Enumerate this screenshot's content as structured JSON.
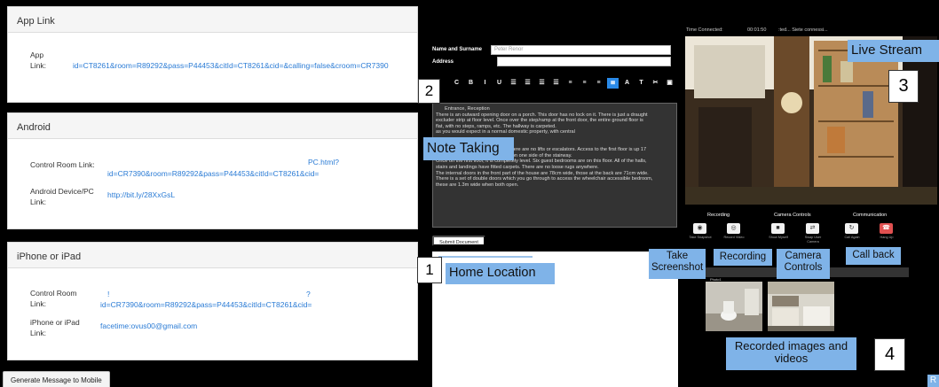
{
  "left": {
    "app": {
      "title": "App Link",
      "label_line1": "App",
      "label_line2": "Link:",
      "value": "id=CT8261&room=R89292&pass=P44453&citId=CT8261&cid=&calling=false&croom=CR7390"
    },
    "android": {
      "title": "Android",
      "control_room_label": "Control Room Link:",
      "control_room_value_top": "PC.html?",
      "control_room_value": "id=CR7390&room=R89292&pass=P44453&citId=CT8261&cid=",
      "device_label_line1": "Android Device/PC",
      "device_label_line2": "Link:",
      "device_value": "http://bit.ly/28XxGsL"
    },
    "ios": {
      "title": "iPhone or iPad",
      "control_room_label_line1": "Control Room",
      "control_room_label_line2": "Link:",
      "control_room_value_top_left": "!",
      "control_room_value_top_right": "?",
      "control_room_value": "id=CR7390&room=R89292&pass=P44453&citId=CT8261&cid=",
      "device_label_line1": "iPhone or iPad",
      "device_label_line2": "Link:",
      "device_value": "facetime:ovus00@gmail.com"
    },
    "generate_button": "Generate Message to Mobile"
  },
  "notes": {
    "name_label": "Name and Surname",
    "name_value": "Peter Renor",
    "address_label": "Address",
    "address_value": "",
    "toolbar": [
      "C",
      "B",
      "I",
      "U",
      "☰",
      "☰",
      "☰",
      "☰",
      "≡",
      "≡",
      "≡",
      "≣",
      "A",
      "T"
    ],
    "toolbar2": [
      "✂",
      "▣"
    ],
    "editor_lines": [
      "Entrance, Reception",
      "There is an outward opening door on a porch. This door has no lock on it. There is just a draught",
      "excluder strip at floor level. Once over the step/ramp at the front door, the entire ground floor is",
      "flat, with no steps, ramps, etc. The hallway is carpeted.",
      "                       as you would expect in a normal domestic property, with central",
      "",
      "",
      "As this is an Edwardian property, there are no lifts or escalators. Access to the first floor is up 17",
      "carpeted steps, there is a handrail on one side of the stairway.",
      "Once on the first floor, it is completely level. Six guest bedrooms are on this floor. All of the halls,",
      "stairs and landings have fitted carpets. There are no loose rugs anywhere.",
      "The internal doors in the front part of the house are 78cm wide, those at the back are 71cm wide.",
      "There is a set of double doors which you go through to access the wheelchair accessible bedroom,",
      "these are 1.3m wide when both open."
    ],
    "submit_label": "Submit Document"
  },
  "stream": {
    "time_label": "Time Connected:",
    "time_value": "00:01:50",
    "status_text": ":ted... Siete connessi...",
    "sections": {
      "recording": "Recording",
      "camera": "Camera Controls",
      "communication": "Communication"
    },
    "controls": [
      {
        "icon": "camera-icon",
        "glyph": "◉",
        "label": "Take Snapshot",
        "color": "#f2f2f2"
      },
      {
        "icon": "record-icon",
        "glyph": "◎",
        "label": "Record Video",
        "color": "#f2f2f2"
      },
      {
        "icon": "video-icon",
        "glyph": "■",
        "label": "Show Myself",
        "color": "#f2f2f2"
      },
      {
        "icon": "swap-icon",
        "glyph": "⇄",
        "label": "Swap User Camera",
        "color": "#f2f2f2"
      },
      {
        "icon": "refresh-icon",
        "glyph": "↻",
        "label": "Call Again",
        "color": "#f2f2f2"
      },
      {
        "icon": "hangup-icon",
        "glyph": "☎",
        "label": "Hang Up",
        "color": "#e05050"
      }
    ],
    "thumb_caption": "Photo1"
  },
  "callouts": {
    "note_taking": "Note Taking",
    "home_location": "Home Location",
    "live_stream": "Live Stream",
    "take_screenshot": "Take Screenshot",
    "recording": "Recording",
    "camera_controls": "Camera Controls",
    "call_back": "Call back",
    "recorded": "Recorded images and videos",
    "num1": "1",
    "num2": "2",
    "num3": "3",
    "num4": "4",
    "corner": "R"
  },
  "colors": {
    "link": "#2a7bd5",
    "callout": "#7fb3e8",
    "active_tool": "#2a8ae8",
    "hangup": "#e05050"
  }
}
